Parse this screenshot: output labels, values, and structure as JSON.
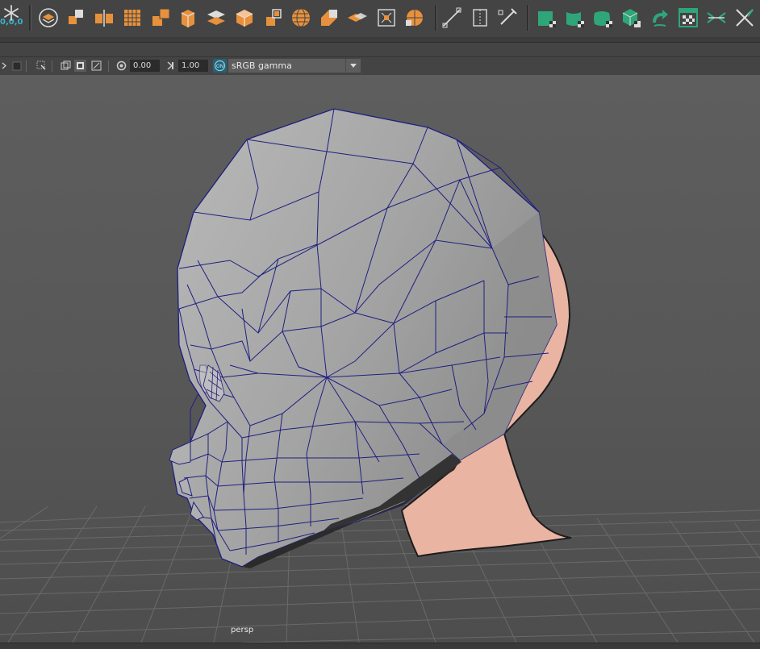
{
  "shelf": {
    "coord_readout": "0,0,0",
    "icons": [
      "snowflake-icon",
      "make-live-icon",
      "poly-combine-icon",
      "poly-separate-icon",
      "poly-smooth-icon",
      "poly-extract-icon",
      "poly-split-icon",
      "poly-booleans-icon",
      "poly-cube-icon",
      "poly-bevel-icon",
      "poly-sphere-icon",
      "poly-extrude-icon",
      "poly-append-icon",
      "poly-bridge-icon",
      "poly-ball-icon",
      "multi-cut-icon",
      "insert-edgeloop-icon",
      "target-weld-icon",
      "uv-planar-icon",
      "uv-cylindrical-icon",
      "uv-spherical-icon",
      "uv-automatic-icon",
      "uv-unfold-icon",
      "uv-checker-icon",
      "uv-layout-icon",
      "uv-cut-icon"
    ]
  },
  "panel_toolbar": {
    "exposure_value": "0.00",
    "gamma_value": "1.00",
    "color_space": "sRGB gamma",
    "cm_badge": "ON"
  },
  "viewport": {
    "camera_label": "persp",
    "colors": {
      "mesh": "#a8a8a8",
      "wire": "#1f1f80",
      "skin": "#eab4a2",
      "background": "#5a5a5a"
    }
  }
}
